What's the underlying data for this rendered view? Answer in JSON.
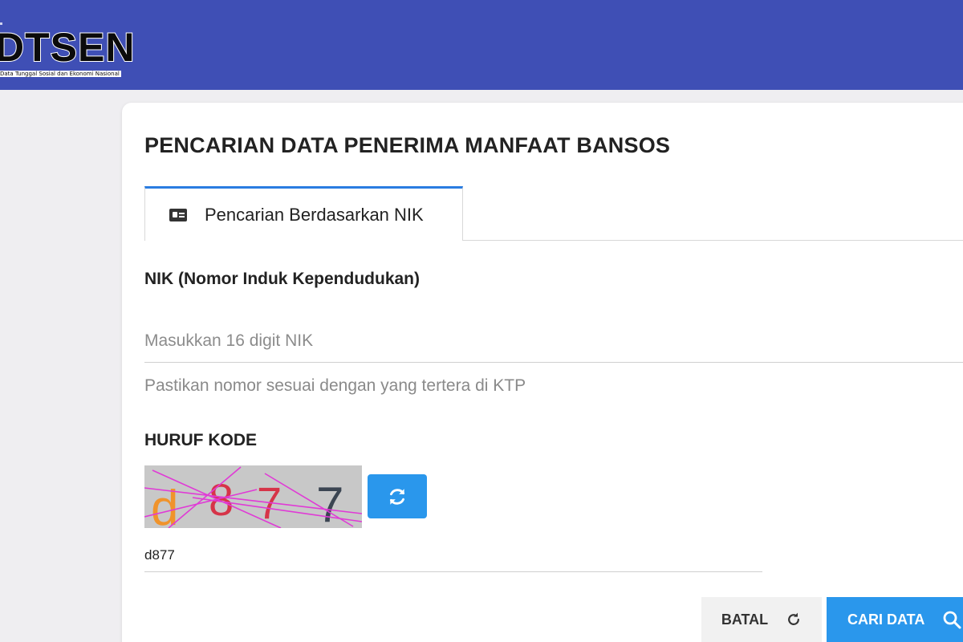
{
  "header": {
    "logo_text": "DTSEN",
    "logo_subtitle": "Data Tunggal Sosial dan Ekonomi Nasional",
    "background": "#3f4fb5"
  },
  "page": {
    "title": "PENCARIAN DATA PENERIMA MANFAAT BANSOS"
  },
  "tabs": [
    {
      "label": "Pencarian Berdasarkan NIK",
      "icon": "id-card-icon",
      "active": true
    }
  ],
  "nik": {
    "label": "NIK (Nomor Induk Kependudukan)",
    "placeholder": "Masukkan 16 digit NIK",
    "value": "",
    "helper": "Pastikan nomor sesuai dengan yang tertera di KTP"
  },
  "captcha": {
    "label": "HURUF KODE",
    "chars": [
      "d",
      "8",
      "7",
      "7"
    ],
    "char_colors": [
      "#f0932b",
      "#d63448",
      "#d63448",
      "#3b4552"
    ],
    "input_value": "d877",
    "refresh_icon": "refresh-icon"
  },
  "actions": {
    "cancel_label": "BATAL",
    "cancel_icon": "reset-icon",
    "search_label": "CARI DATA",
    "search_icon": "search-icon",
    "accent": "#2a97ec"
  }
}
